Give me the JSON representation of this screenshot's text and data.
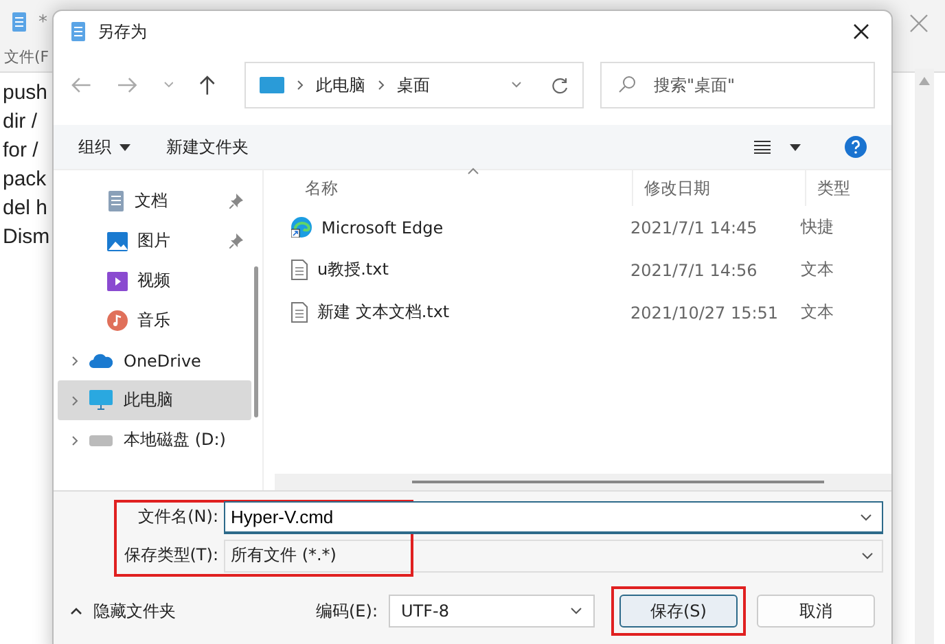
{
  "background_window": {
    "title": "*",
    "menu": "文件(F",
    "lines": [
      "push",
      "dir /",
      "for /",
      "pack",
      "del h",
      "Dism"
    ]
  },
  "dialog": {
    "title": "另存为",
    "breadcrumb": [
      "此电脑",
      "桌面"
    ],
    "search": {
      "placeholder": "搜索\"桌面\""
    },
    "toolbar": {
      "organize": "组织",
      "new_folder": "新建文件夹"
    },
    "sidebar": {
      "items": [
        {
          "label": "文档",
          "kind": "docs",
          "pinned": true,
          "expandable": false,
          "selected": false
        },
        {
          "label": "图片",
          "kind": "pictures",
          "pinned": true,
          "expandable": false,
          "selected": false
        },
        {
          "label": "视频",
          "kind": "videos",
          "pinned": false,
          "expandable": false,
          "selected": false
        },
        {
          "label": "音乐",
          "kind": "music",
          "pinned": false,
          "expandable": false,
          "selected": false
        },
        {
          "label": "OneDrive",
          "kind": "cloud",
          "pinned": false,
          "expandable": true,
          "selected": false
        },
        {
          "label": "此电脑",
          "kind": "pc",
          "pinned": false,
          "expandable": true,
          "selected": true
        },
        {
          "label": "本地磁盘 (D:)",
          "kind": "disk",
          "pinned": false,
          "expandable": true,
          "selected": false
        }
      ]
    },
    "table": {
      "columns": [
        "名称",
        "修改日期",
        "类型"
      ],
      "rows": [
        {
          "name": "Microsoft Edge",
          "kind": "shortcut",
          "date": "2021/7/1 14:45",
          "type": "快捷"
        },
        {
          "name": "u教授.txt",
          "kind": "text",
          "date": "2021/7/1 14:56",
          "type": "文本"
        },
        {
          "name": "新建 文本文档.txt",
          "kind": "text",
          "date": "2021/10/27 15:51",
          "type": "文本"
        }
      ]
    },
    "filename": {
      "label": "文件名(N):",
      "value": "Hyper-V.cmd"
    },
    "filetype": {
      "label": "保存类型(T):",
      "value": "所有文件 (*.*)"
    },
    "hide_folders": "隐藏文件夹",
    "encoding": {
      "label": "编码(E):",
      "value": "UTF-8"
    },
    "buttons": [
      "保存(S)",
      "取消"
    ]
  }
}
